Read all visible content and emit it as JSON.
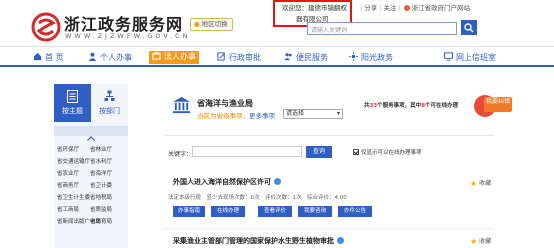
{
  "header": {
    "title": "浙江政务服务网",
    "url_text": "WWW.ZJZWFW.GOV.CN",
    "region_label": "地区切换",
    "welcome_line1": "欢迎您：建德市镇翻权",
    "welcome_line2": "器有限公司",
    "links": [
      "分享",
      "关注",
      "浙江省政府门户网站"
    ],
    "search_placeholder": "请输入关键词"
  },
  "nav": {
    "items": [
      {
        "label": "首 页",
        "icon": "home-icon"
      },
      {
        "label": "个人办事",
        "icon": "person-icon"
      },
      {
        "label": "法人办事",
        "icon": "briefcase-icon",
        "active": true
      },
      {
        "label": "行政审批",
        "icon": "edit-icon"
      },
      {
        "label": "便民服务",
        "icon": "people-icon"
      },
      {
        "label": "阳光政务",
        "icon": "sun-icon"
      },
      {
        "label": "网上信班室",
        "icon": "monitor-icon"
      }
    ]
  },
  "left_panel": {
    "tab_topic": "按主题",
    "tab_dept": "按部门",
    "departments": [
      [
        "省环保厅",
        "省林业厅"
      ],
      [
        "省交通运输厅",
        "省水利厅"
      ],
      [
        "省农业厅",
        "省海洋厅"
      ],
      [
        "省商务厅",
        "省卫计委"
      ],
      [
        "省卫生计生委",
        "省地税局"
      ],
      [
        "省工商局",
        "省质监局"
      ],
      [
        "省新闻出版广电局",
        "省体育局"
      ]
    ]
  },
  "bureau": {
    "name": "省海洋与渔业局",
    "sub_prefix": "当前为省级事项，",
    "switch_text": "更多事项",
    "select_value": "请选择",
    "stats_prefix": "共",
    "stats_total": "33",
    "stats_mid": "个服务事项，其中",
    "stats_online": "8",
    "stats_suffix": "个可在线办理",
    "badge_label": "我要纠错"
  },
  "filter": {
    "keyword_label": "关键字：",
    "query_label": "查询",
    "online_only_label": "仅显示可以在线办理事项"
  },
  "items": [
    {
      "title": "外国人进入海洋自然保护区许可",
      "meta": "法定本级行使　显少去现场次数：0次　评价次数：1次　综合评价：4.00",
      "fav": "收藏",
      "actions": [
        "办事指南",
        "在线办理",
        "查看评价",
        "我要咨询",
        "办件公告"
      ]
    },
    {
      "title": "采集渔业主管部门管理的国家保护水生野生植物审批",
      "fav": "收藏"
    }
  ]
}
